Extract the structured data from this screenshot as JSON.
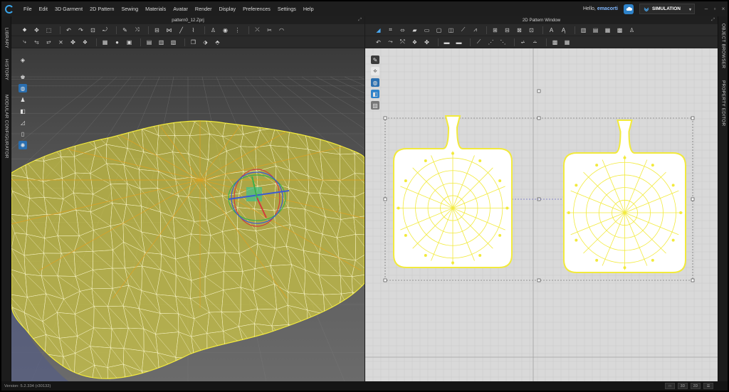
{
  "menu": {
    "items": [
      "File",
      "Edit",
      "3D Garment",
      "2D Pattern",
      "Sewing",
      "Materials",
      "Avatar",
      "Render",
      "Display",
      "Preferences",
      "Settings",
      "Help"
    ]
  },
  "user": {
    "greeting": "Hello,",
    "name": "emacorti"
  },
  "mode": {
    "label": "SIMULATION"
  },
  "left_tabs": [
    "LIBRARY",
    "HISTORY",
    "MODULAR CONFIGURATOR"
  ],
  "right_tabs": [
    "OBJECT BROWSER",
    "PROPERTY EDITOR"
  ],
  "panel3d": {
    "title": "pattern0_12.Zprj"
  },
  "panel2d": {
    "title": "2D Pattern Window"
  },
  "status": {
    "version": "Version: 5.2.334 (r30132)",
    "buttons": [
      "□",
      "3D",
      "2D",
      "☰"
    ]
  },
  "colors": {
    "accent": "#2e82c9",
    "mesh": "#f2ea3c",
    "menubar": "#1e1e1e",
    "viewport2d": "#d9d9d9"
  }
}
